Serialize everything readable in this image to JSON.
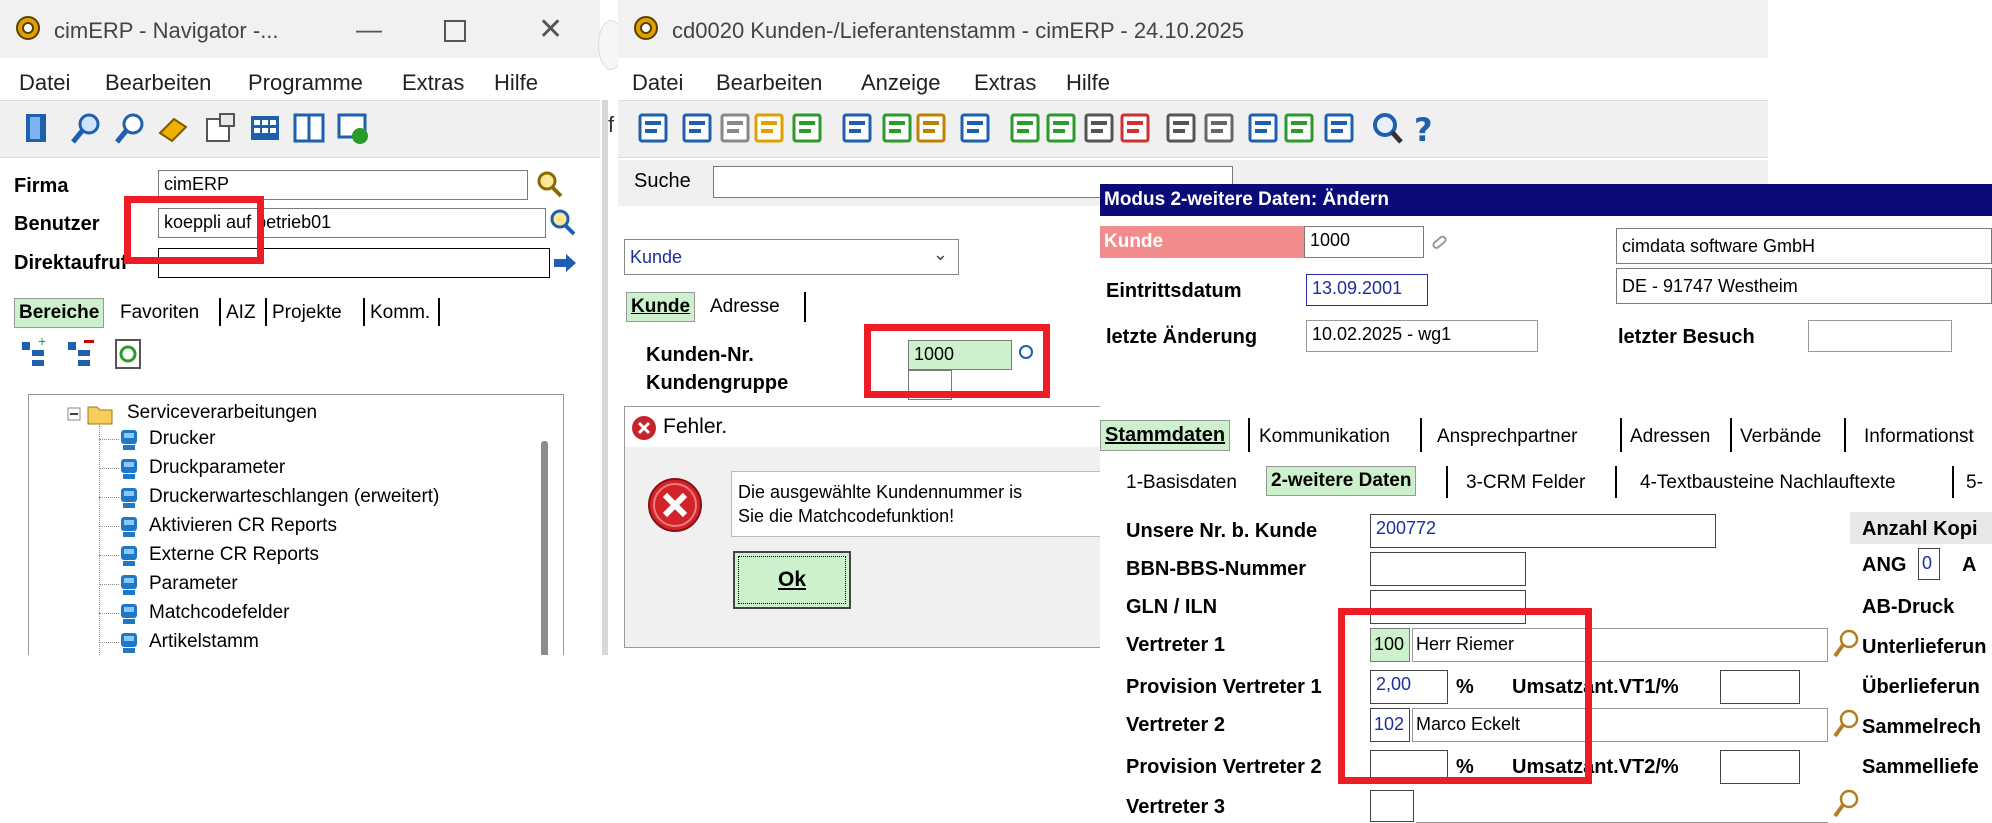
{
  "nav": {
    "title": "cimERP - Navigator -...",
    "menu": [
      "Datei",
      "Bearbeiten",
      "Programme",
      "Extras",
      "Hilfe"
    ],
    "firma_label": "Firma",
    "firma_value": "cimERP",
    "benutzer_label": "Benutzer",
    "benutzer_value": "koeppli auf betrieb01",
    "direktaufruf_label": "Direktaufruf",
    "direktaufruf_value": "",
    "tabs": [
      "Bereiche",
      "Favoriten",
      "AIZ",
      "Projekte",
      "Komm."
    ],
    "tree_root": "Serviceverarbeitungen",
    "tree_items": [
      "Drucker",
      "Druckparameter",
      "Druckerwarteschlangen (erweitert)",
      "Aktivieren CR Reports",
      "Externe CR Reports",
      "Parameter",
      "Matchcodefelder",
      "Artikelstamm"
    ]
  },
  "cd": {
    "title": "cd0020 Kunden-/Lieferantenstamm - cimERP - 24.10.2025",
    "menu": [
      "Datei",
      "Bearbeiten",
      "Anzeige",
      "Extras",
      "Hilfe"
    ],
    "suche_label": "Suche",
    "suche_value": "",
    "kunde_select": "Kunde",
    "tabs": [
      "Kunde",
      "Adresse"
    ],
    "kundennr_label": "Kunden-Nr.",
    "kundennr_value": "1000",
    "kundengruppe_label": "Kundengruppe",
    "stray_char": "f"
  },
  "dialog": {
    "title": "Fehler.",
    "message_line1": "Die ausgewählte Kundennummer is",
    "message_line2": "Sie die Matchcodefunktion!",
    "ok_label": "Ok"
  },
  "detail": {
    "mode_header": "Modus 2-weitere Daten: Ändern",
    "kunde_label": "Kunde",
    "kunde_value": "1000",
    "company_name": "cimdata software GmbH",
    "company_city": "DE - 91747 Westheim",
    "eintritt_label": "Eintrittsdatum",
    "eintritt_value": "13.09.2001",
    "aenderung_label": "letzte Änderung",
    "aenderung_value": "10.02.2025 - wg1",
    "besuch_label": "letzter Besuch",
    "besuch_value": "",
    "main_tabs": [
      "Stammdaten",
      "Kommunikation",
      "Ansprechpartner",
      "Adressen",
      "Verbände",
      "Informationst"
    ],
    "sub_tabs": [
      "1-Basisdaten",
      "2-weitere Daten",
      "3-CRM Felder",
      "4-Textbausteine Nachlauftexte",
      "5-"
    ],
    "unsere_nr_label": "Unsere Nr. b. Kunde",
    "unsere_nr_value": "200772",
    "bbn_label": "BBN-BBS-Nummer",
    "gln_label": "GLN / ILN",
    "vertreter1_label": "Vertreter 1",
    "vertreter1_code": "100",
    "vertreter1_name": "Herr Riemer",
    "prov1_label": "Provision Vertreter 1",
    "prov1_value": "2,00",
    "percent": "%",
    "umsatz1_label": "Umsatzant.VT1/%",
    "vertreter2_label": "Vertreter 2",
    "vertreter2_code": "102",
    "vertreter2_name": "Marco Eckelt",
    "prov2_label": "Provision Vertreter 2",
    "umsatz2_label": "Umsatzant.VT2/%",
    "vertreter3_label": "Vertreter 3",
    "right_labels": {
      "anzahl": "Anzahl Kopi",
      "ang": "ANG",
      "ang_value": "0",
      "a": "A",
      "ab_druck": "AB-Druck",
      "unterliefer": "Unterlieferun",
      "ueberliefer": "Überlieferun",
      "sammelrech": "Sammelrech",
      "sammelliefe": "Sammelliefe"
    }
  },
  "colors": {
    "mode_header_bg": "#0a0a78",
    "kunde_label_bg": "#f28b8b",
    "highlight_green": "#cdf0cd",
    "red_box": "#ee1c25",
    "link_blue": "#1c2f9a"
  }
}
